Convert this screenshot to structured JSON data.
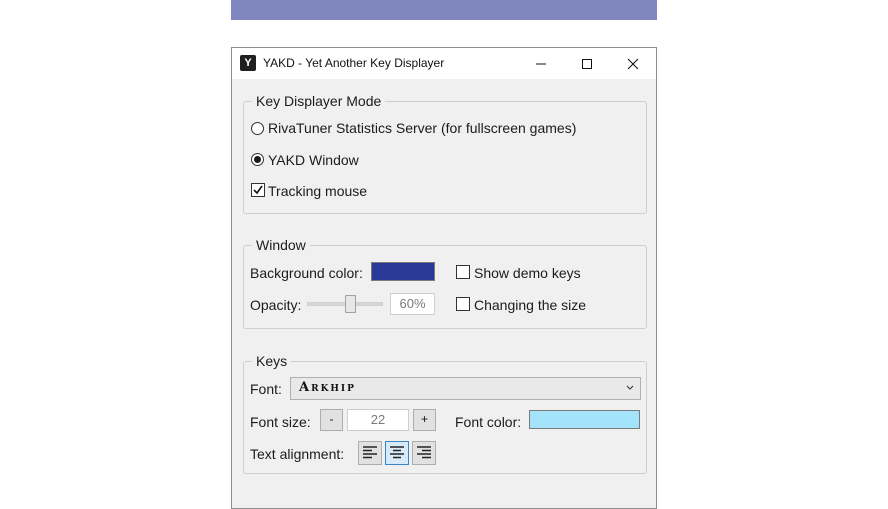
{
  "window": {
    "title": "YAKD - Yet Another Key Displayer",
    "app_icon_letter": "Y"
  },
  "mode_group": {
    "legend": "Key Displayer Mode",
    "options": [
      {
        "label": "RivaTuner Statistics Server (for fullscreen games)",
        "selected": false
      },
      {
        "label": "YAKD Window",
        "selected": true
      }
    ],
    "tracking_mouse": {
      "label": "Tracking mouse",
      "checked": true
    }
  },
  "window_group": {
    "legend": "Window",
    "background_color_label": "Background color:",
    "background_color": "#2b3996",
    "opacity_label": "Opacity:",
    "opacity_value": "60%",
    "opacity_fraction": 0.6,
    "show_demo_keys": {
      "label": "Show demo keys",
      "checked": false
    },
    "changing_size": {
      "label": "Changing the size",
      "checked": false
    }
  },
  "keys_group": {
    "legend": "Keys",
    "font_label": "Font:",
    "font_value": "Arkhip",
    "font_size_label": "Font size:",
    "font_size_minus": "-",
    "font_size_value": "22",
    "font_size_plus": "+",
    "font_color_label": "Font color:",
    "font_color": "#a3e4fa",
    "text_alignment_label": "Text alignment:",
    "alignments": [
      "align-left",
      "align-center",
      "align-right"
    ],
    "selected_alignment": "align-center"
  },
  "colors": {
    "demo_bar": "#8087c0"
  }
}
